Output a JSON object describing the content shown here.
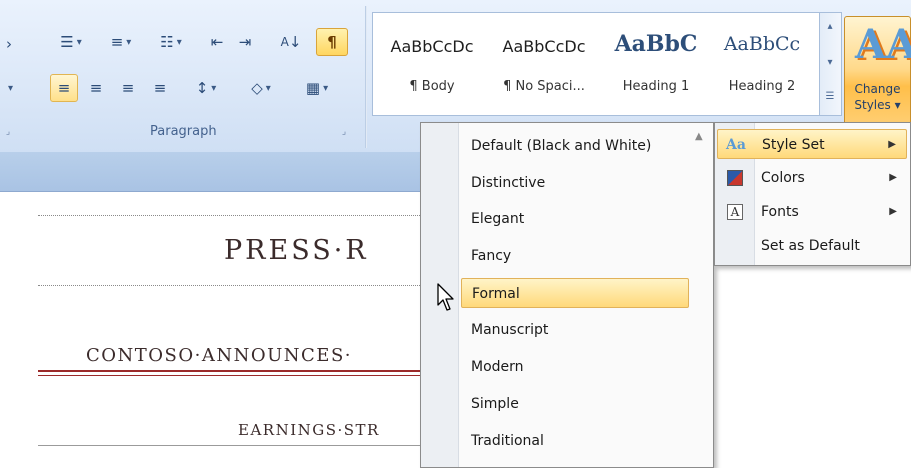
{
  "ribbon": {
    "paragraph_group": {
      "label": "Paragraph",
      "row1": [
        {
          "name": "bullets-button",
          "glyph": "☰",
          "has_dropdown": true
        },
        {
          "name": "numbering-button",
          "glyph": "≡",
          "has_dropdown": true
        },
        {
          "name": "multilevel-list-button",
          "glyph": "☷",
          "has_dropdown": true
        },
        {
          "name": "decrease-indent-button",
          "glyph": "⇤"
        },
        {
          "name": "increase-indent-button",
          "glyph": "⇥"
        },
        {
          "name": "sort-button",
          "glyph": "↓"
        },
        {
          "name": "show-formatting-button",
          "glyph": "¶"
        }
      ],
      "row2": [
        {
          "name": "align-left-button",
          "glyph": "≡"
        },
        {
          "name": "align-center-button",
          "glyph": "≡"
        },
        {
          "name": "align-right-button",
          "glyph": "≡"
        },
        {
          "name": "justify-button",
          "glyph": "≡"
        },
        {
          "name": "line-spacing-button",
          "glyph": "↕"
        },
        {
          "name": "shading-button",
          "glyph": "◇"
        },
        {
          "name": "borders-button",
          "glyph": "▦"
        }
      ]
    },
    "styles_gallery": [
      {
        "sample": "AaBbCcDc",
        "name": "¶ Body"
      },
      {
        "sample": "AaBbCcDc",
        "name": "¶ No Spaci..."
      },
      {
        "sample": "AaBbC",
        "name": "Heading 1"
      },
      {
        "sample": "AaBbCc",
        "name": "Heading 2"
      }
    ],
    "change_styles": {
      "icon": "AA",
      "label_line1": "Change",
      "label_line2": "Styles ▾"
    }
  },
  "document": {
    "title": "PRESS·R",
    "subtitle": "CONTOSO·ANNOUNCES·",
    "heading": "EARNINGS·STR"
  },
  "change_styles_menu": {
    "items": [
      {
        "label": "Style Set",
        "underline": "y",
        "icon": "style-set-icon"
      },
      {
        "label": "Colors",
        "underline": "C",
        "icon": "colors-icon"
      },
      {
        "label": "Fonts",
        "underline": "F",
        "icon": "fonts-icon"
      },
      {
        "label": "Set as Default",
        "underline": "S",
        "icon": ""
      }
    ]
  },
  "style_set_menu": {
    "items": [
      "Default (Black and White)",
      "Distinctive",
      "Elegant",
      "Fancy",
      "Formal",
      "Manuscript",
      "Modern",
      "Simple",
      "Traditional"
    ],
    "selected": "Formal"
  },
  "colors": {
    "ribbon_bg": "#dce8f8",
    "highlight": "#ffd97a",
    "accent_red": "#9b2a2a"
  }
}
